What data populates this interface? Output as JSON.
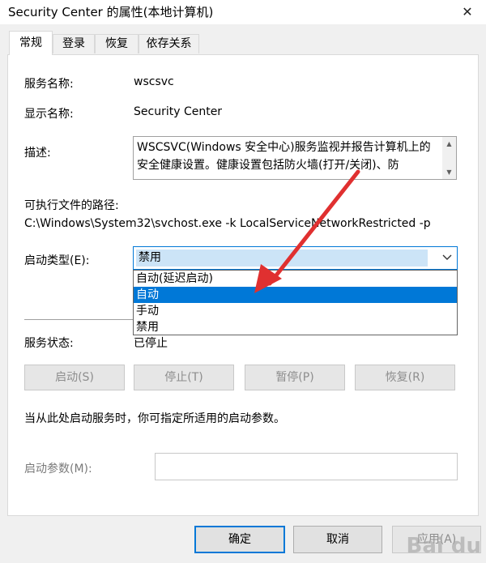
{
  "window": {
    "title": "Security Center 的属性(本地计算机)",
    "close_glyph": "✕"
  },
  "tabs": [
    {
      "label": "常规",
      "active": true
    },
    {
      "label": "登录",
      "active": false
    },
    {
      "label": "恢复",
      "active": false
    },
    {
      "label": "依存关系",
      "active": false
    }
  ],
  "general": {
    "service_name_label": "服务名称:",
    "service_name_value": "wscsvc",
    "display_name_label": "显示名称:",
    "display_name_value": "Security Center",
    "description_label": "描述:",
    "description_value": "WSCSVC(Windows 安全中心)服务监视并报告计算机上的安全健康设置。健康设置包括防火墙(打开/关闭)、防",
    "exe_path_label": "可执行文件的路径:",
    "exe_path_value": "C:\\Windows\\System32\\svchost.exe -k LocalServiceNetworkRestricted -p",
    "startup_type_label": "启动类型(E):",
    "startup_type_value": "禁用",
    "startup_options": [
      {
        "label": "自动(延迟启动)",
        "highlighted": false
      },
      {
        "label": "自动",
        "highlighted": true
      },
      {
        "label": "手动",
        "highlighted": false
      },
      {
        "label": "禁用",
        "highlighted": false
      }
    ],
    "service_status_label": "服务状态:",
    "service_status_value": "已停止",
    "start_button": "启动(S)",
    "stop_button": "停止(T)",
    "pause_button": "暂停(P)",
    "resume_button": "恢复(R)",
    "hint_text": "当从此处启动服务时，你可指定所适用的启动参数。",
    "start_params_label": "启动参数(M):",
    "start_params_value": ""
  },
  "footer": {
    "ok_button": "确定",
    "cancel_button": "取消",
    "apply_button": "应用(A)"
  },
  "annotation": {
    "arrow_color": "#e03030"
  },
  "watermark": {
    "text": "Bai du"
  }
}
